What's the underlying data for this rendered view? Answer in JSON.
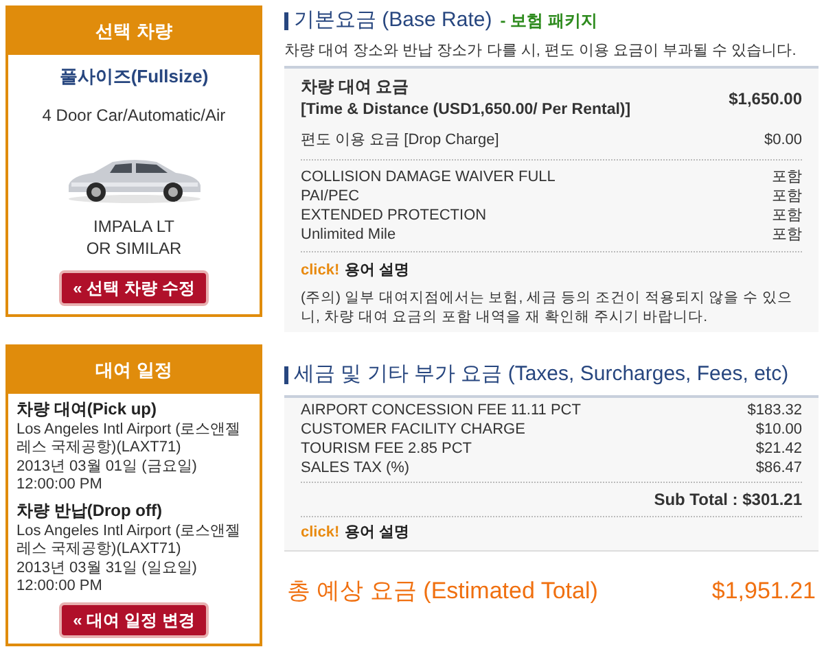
{
  "vehicle_card": {
    "title": "선택 차량",
    "class_name": "풀사이즈(Fullsize)",
    "features": "4 Door Car/Automatic/Air",
    "model_lines": [
      "IMPALA LT",
      "OR SIMILAR"
    ],
    "button": "« 선택 차량 수정"
  },
  "schedule_card": {
    "title": "대여 일정",
    "sections": [
      {
        "heading": "차량 대여(Pick up)",
        "lines": [
          "Los Angeles Intl Airport (로스앤젤",
          "레스 국제공항)(LAXT71)",
          "2013년 03월 01일 (금요일)",
          "12:00:00 PM"
        ]
      },
      {
        "heading": "차량 반납(Drop off)",
        "lines": [
          "Los Angeles Intl Airport (로스앤젤",
          "레스 국제공항)(LAXT71)",
          "2013년 03월 31일 (일요일)",
          "12:00:00 PM"
        ]
      }
    ],
    "button": "« 대여 일정 변경"
  },
  "base_rate": {
    "title": "기본요금 (Base Rate)",
    "package": "- 보험 패키지",
    "notice": "차량 대여 장소와 반납 장소가 다를 시, 편도 이용 요금이 부과될 수 있습니다.",
    "rental_fee": {
      "label": "차량 대여 요금",
      "detail": "[Time & Distance (USD1,650.00/ Per Rental)]",
      "amount": "$1,650.00"
    },
    "drop_charge": {
      "label": "편도 이용 요금 [Drop Charge]",
      "amount": "$0.00"
    },
    "coverages": [
      {
        "name": "COLLISION DAMAGE WAIVER FULL",
        "value": "포함"
      },
      {
        "name": "PAI/PEC",
        "value": "포함"
      },
      {
        "name": "EXTENDED PROTECTION",
        "value": "포함"
      },
      {
        "name": "Unlimited Mile",
        "value": "포함"
      }
    ],
    "click_label": "click!",
    "glossary_link": "용어 설명",
    "caution": "(주의) 일부 대여지점에서는 보험, 세금 등의 조건이 적용되지 않을 수 있으니, 차량 대여 요금의 포함 내역을 재 확인해 주시기 바랍니다."
  },
  "taxes": {
    "title": "세금 및 기타 부가 요금 (Taxes, Surcharges, Fees, etc)",
    "items": [
      {
        "name": "AIRPORT CONCESSION FEE 11.11 PCT",
        "amount": "$183.32"
      },
      {
        "name": "CUSTOMER FACILITY CHARGE",
        "amount": "$10.00"
      },
      {
        "name": "TOURISM FEE 2.85 PCT",
        "amount": "$21.42"
      },
      {
        "name": "SALES TAX (%)",
        "amount": "$86.47"
      }
    ],
    "subtotal": "Sub Total : $301.21",
    "click_label": "click!",
    "glossary_link": "용어 설명"
  },
  "estimated_total": {
    "label": "총 예상 요금 (Estimated Total)",
    "amount": "$1,951.21"
  }
}
